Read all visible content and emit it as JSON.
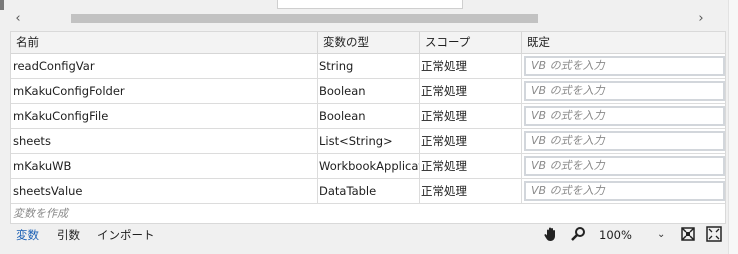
{
  "scrollbar": {
    "left_arrow": "‹",
    "right_arrow": "›"
  },
  "columns": {
    "name": "名前",
    "type": "変数の型",
    "scope": "スコープ",
    "default": "既定"
  },
  "rows": [
    {
      "name": "readConfigVar",
      "type": "String",
      "scope": "正常処理",
      "default_placeholder": "VB の式を入力"
    },
    {
      "name": "mKakuConfigFolder",
      "type": "Boolean",
      "scope": "正常処理",
      "default_placeholder": "VB の式を入力"
    },
    {
      "name": "mKakuConfigFile",
      "type": "Boolean",
      "scope": "正常処理",
      "default_placeholder": "VB の式を入力"
    },
    {
      "name": "sheets",
      "type": "List<String>",
      "scope": "正常処理",
      "default_placeholder": "VB の式を入力"
    },
    {
      "name": "mKakuWB",
      "type": "WorkbookApplication",
      "scope": "正常処理",
      "default_placeholder": "VB の式を入力"
    },
    {
      "name": "sheetsValue",
      "type": "DataTable",
      "scope": "正常処理",
      "default_placeholder": "VB の式を入力"
    }
  ],
  "create_variable": "変数を作成",
  "footer": {
    "tabs": [
      "変数",
      "引数",
      "インポート"
    ],
    "zoom": "100%",
    "zoom_arrow": "⌄",
    "icons": [
      "hand-icon",
      "magnifier-icon",
      "fit-to-screen-icon",
      "overview-icon"
    ]
  },
  "colors": {
    "active_tab": "#1a5fb4",
    "placeholder": "#8a8a8a",
    "header_bg": "#f3f3f3"
  }
}
